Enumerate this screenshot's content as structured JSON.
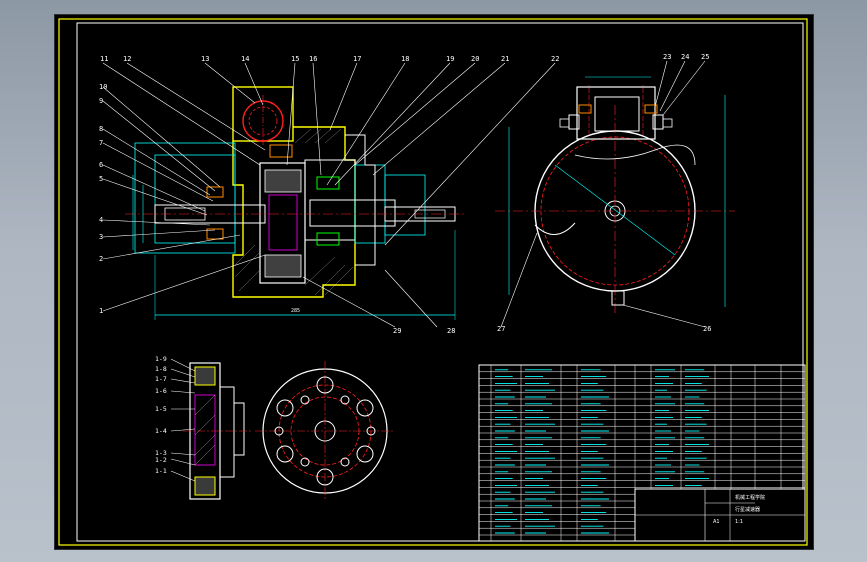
{
  "drawing": {
    "leaders_left": [
      "11",
      "12",
      "13",
      "14",
      "15",
      "16",
      "17",
      "18",
      "19",
      "20",
      "21",
      "22"
    ],
    "leaders_side": [
      "10",
      "9",
      "8",
      "7",
      "6",
      "5",
      "4",
      "3",
      "2",
      "1"
    ],
    "leaders_bottom": [
      "29",
      "28"
    ],
    "dim_overall": "285",
    "right_labels": [
      "23",
      "24",
      "25",
      "26",
      "27"
    ],
    "detail_labels": [
      "1-9",
      "1-8",
      "1-7",
      "1-6",
      "1-5",
      "1-4",
      "1-3",
      "1-2",
      "1-1"
    ],
    "colors": {
      "outline": "#ffffff",
      "yellow": "#ffff00",
      "cyan": "#00ffff",
      "red": "#ff2020",
      "green": "#00ff00",
      "magenta": "#ff00ff",
      "orange": "#ff8c00"
    }
  },
  "title_block": {
    "scale": "1:1",
    "sheet": "A1",
    "org": "机械工程学院",
    "name": "行星减速器"
  }
}
